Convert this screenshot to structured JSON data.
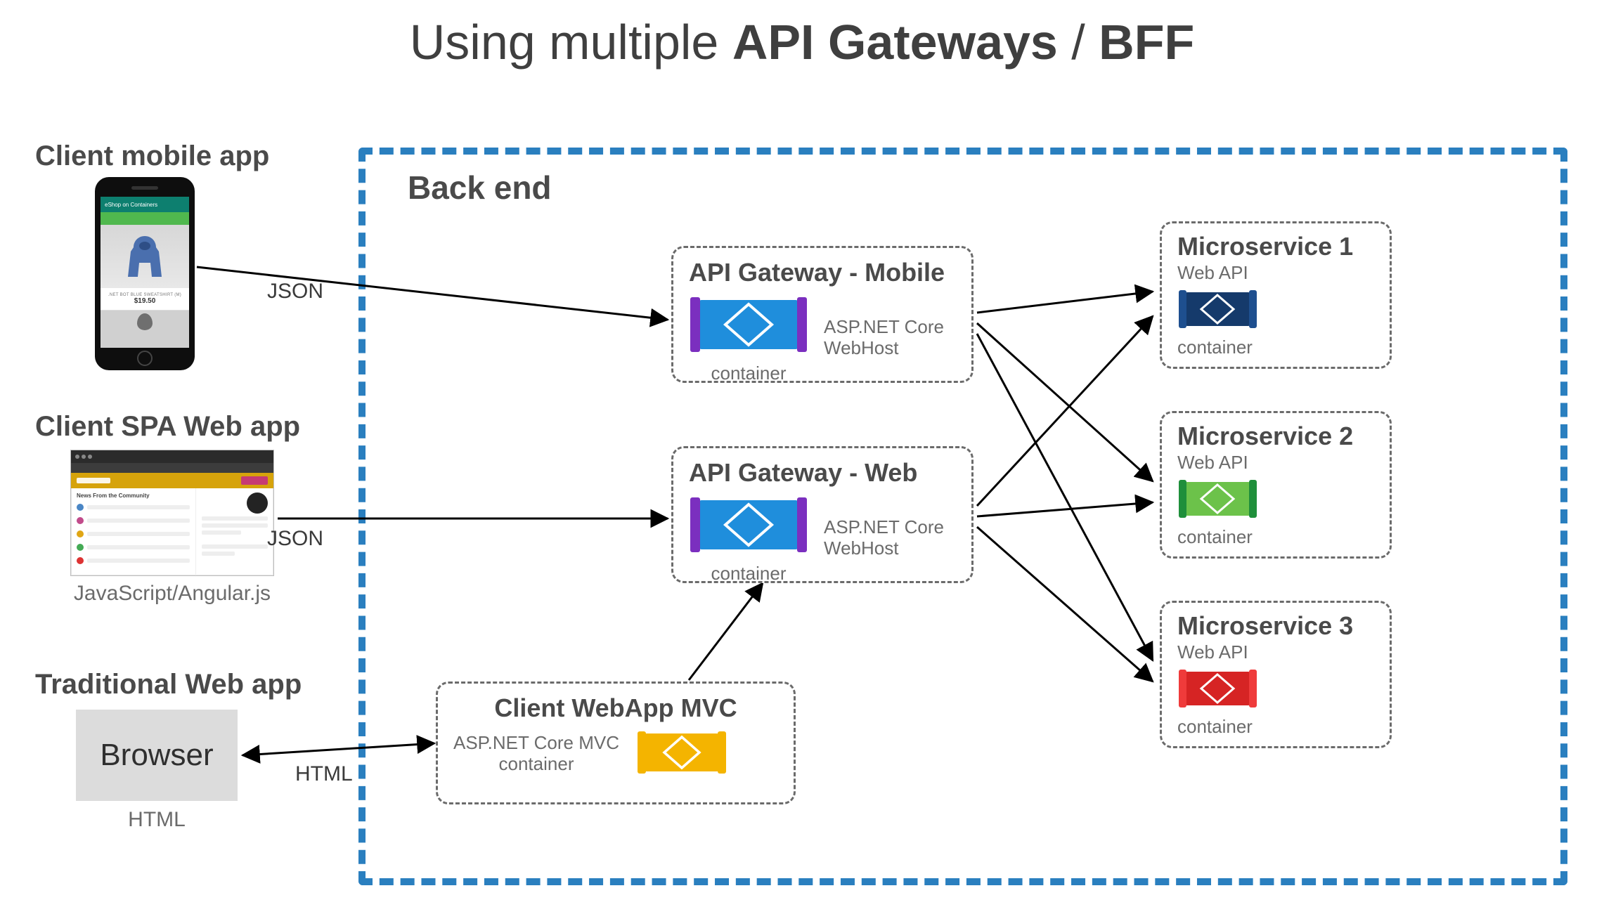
{
  "title": {
    "prefix": "Using multiple ",
    "bold1": "API Gateways",
    "sep": " / ",
    "bold2": "BFF"
  },
  "backend_label": "Back end",
  "clients": {
    "mobile": {
      "heading": "Client mobile app"
    },
    "spa": {
      "heading": "Client SPA Web app",
      "caption": "JavaScript/Angular.js"
    },
    "web": {
      "heading": "Traditional Web app",
      "box": "Browser",
      "caption": "HTML"
    }
  },
  "phone": {
    "topbar": "eShop on Containers",
    "name": ".NET BOT BLUE SWEATSHIRT (M)",
    "price": "$19.50"
  },
  "spa_card": {
    "headline": "News From the Community"
  },
  "edges": {
    "json1": "JSON",
    "json2": "JSON",
    "html": "HTML"
  },
  "gateways": {
    "mobile": {
      "title": "API Gateway - Mobile",
      "sub1": "ASP.NET Core",
      "sub2": "WebHost",
      "container": "container"
    },
    "web": {
      "title": "API Gateway - Web",
      "sub1": "ASP.NET Core",
      "sub2": "WebHost",
      "container": "container"
    }
  },
  "mvc": {
    "title": "Client WebApp MVC",
    "sub1": "ASP.NET Core MVC",
    "sub2": "container"
  },
  "microservices": {
    "ms1": {
      "title": "Microservice 1",
      "sub": "Web API",
      "container": "container",
      "color": "#153a6b",
      "accent": "#1e4f8f"
    },
    "ms2": {
      "title": "Microservice 2",
      "sub": "Web API",
      "container": "container",
      "color": "#6cc24a",
      "accent": "#1f8f3b"
    },
    "ms3": {
      "title": "Microservice 3",
      "sub": "Web API",
      "container": "container",
      "color": "#d62424",
      "accent": "#ef3b3b"
    }
  },
  "container_word": "container"
}
